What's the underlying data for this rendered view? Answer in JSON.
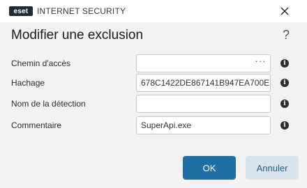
{
  "titlebar": {
    "logo_text": "eset",
    "product_name": "INTERNET SECURITY"
  },
  "dialog": {
    "title": "Modifier une exclusion",
    "help": "?"
  },
  "fields": [
    {
      "label": "Chemin d'accès",
      "value": "",
      "browse": "..."
    },
    {
      "label": "Hachage",
      "value": "678C1422DE867141B947EA700E"
    },
    {
      "label": "Nom de la détection",
      "value": ""
    },
    {
      "label": "Commentaire",
      "value": "SuperApi.exe"
    }
  ],
  "buttons": {
    "ok": "OK",
    "cancel": "Annuler"
  },
  "colors": {
    "primary": "#1f6fa5",
    "secondary": "#d7e4ee",
    "logo": "#1e2c33"
  }
}
